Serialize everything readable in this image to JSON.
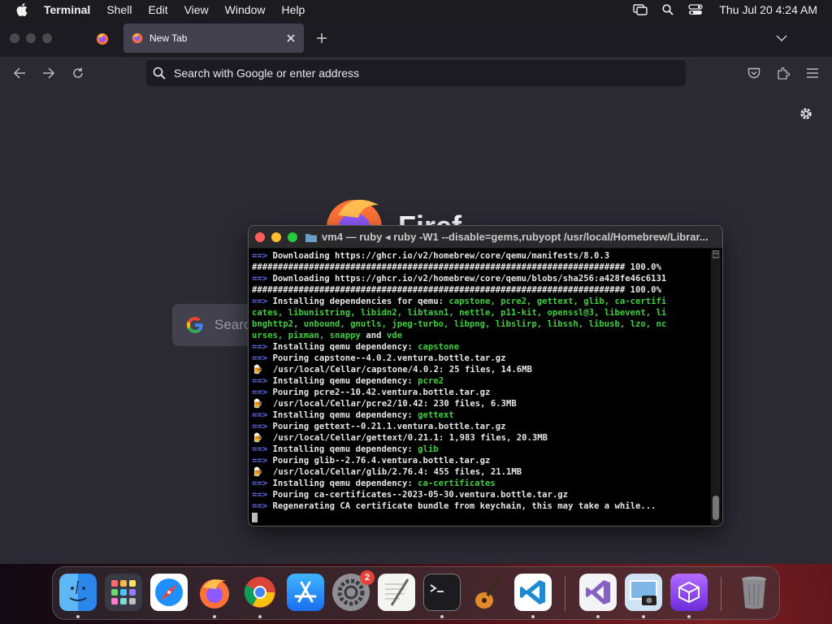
{
  "menubar": {
    "app_name": "Terminal",
    "menus": [
      "Shell",
      "Edit",
      "View",
      "Window",
      "Help"
    ],
    "clock": "Thu Jul 20  4:24 AM"
  },
  "browser": {
    "active_tab_title": "New Tab",
    "url_placeholder": "Search with Google or enter address",
    "search_placeholder": "Searc",
    "wordmark": "Firef"
  },
  "terminal": {
    "title": "vm4 — ruby ◂ ruby -W1 --disable=gems,rubyopt /usr/local/Homebrew/Librar...",
    "lines": [
      {
        "arrow": "==>",
        "text": " Downloading https://ghcr.io/v2/homebrew/core/qemu/manifests/8.0.3",
        "green": ""
      },
      {
        "arrow": "",
        "text": "######################################################################## 100.0%",
        "green": ""
      },
      {
        "arrow": "==>",
        "text": " Downloading https://ghcr.io/v2/homebrew/core/qemu/blobs/sha256:a428fe46c6131",
        "green": ""
      },
      {
        "arrow": "",
        "text": "######################################################################## 100.0%",
        "green": ""
      },
      {
        "arrow": "==>",
        "text": " Installing dependencies for qemu: ",
        "green": "capstone, pcre2, gettext, glib, ca-certifi"
      },
      {
        "arrow": "",
        "text": "",
        "green": "cates, libunistring, libidn2, libtasn1, nettle, p11-kit, openssl@3, libevent, li"
      },
      {
        "arrow": "",
        "text": "",
        "green": "bnghttp2, unbound, gnutls, jpeg-turbo, libpng, libslirp, libssh, libusb, lzo, nc"
      },
      {
        "arrow": "",
        "text": "",
        "green": "urses, pixman, snappy",
        "tail": " and ",
        "green2": "vde"
      },
      {
        "arrow": "==>",
        "text": " Installing qemu dependency: ",
        "green": "capstone"
      },
      {
        "arrow": "==>",
        "text": " Pouring capstone--4.0.2.ventura.bottle.tar.gz",
        "green": ""
      },
      {
        "beer": true,
        "text": "  /usr/local/Cellar/capstone/4.0.2: 25 files, 14.6MB"
      },
      {
        "arrow": "==>",
        "text": " Installing qemu dependency: ",
        "green": "pcre2"
      },
      {
        "arrow": "==>",
        "text": " Pouring pcre2--10.42.ventura.bottle.tar.gz",
        "green": ""
      },
      {
        "beer": true,
        "text": "  /usr/local/Cellar/pcre2/10.42: 230 files, 6.3MB"
      },
      {
        "arrow": "==>",
        "text": " Installing qemu dependency: ",
        "green": "gettext"
      },
      {
        "arrow": "==>",
        "text": " Pouring gettext--0.21.1.ventura.bottle.tar.gz",
        "green": ""
      },
      {
        "beer": true,
        "text": "  /usr/local/Cellar/gettext/0.21.1: 1,983 files, 20.3MB"
      },
      {
        "arrow": "==>",
        "text": " Installing qemu dependency: ",
        "green": "glib"
      },
      {
        "arrow": "==>",
        "text": " Pouring glib--2.76.4.ventura.bottle.tar.gz",
        "green": ""
      },
      {
        "beer": true,
        "text": "  /usr/local/Cellar/glib/2.76.4: 455 files, 21.1MB"
      },
      {
        "arrow": "==>",
        "text": " Installing qemu dependency: ",
        "green": "ca-certificates"
      },
      {
        "arrow": "==>",
        "text": " Pouring ca-certificates--2023-05-30.ventura.bottle.tar.gz",
        "green": ""
      },
      {
        "arrow": "==>",
        "text": " Regenerating CA certificate bundle from keychain, this may take a while...",
        "green": ""
      }
    ]
  },
  "dock": {
    "settings_badge": "2"
  },
  "colors": {
    "arrow": "#5b6cf5",
    "package": "#3fcf3f",
    "close": "#ff5f57",
    "minimize": "#febc2e",
    "zoom": "#28c840"
  }
}
